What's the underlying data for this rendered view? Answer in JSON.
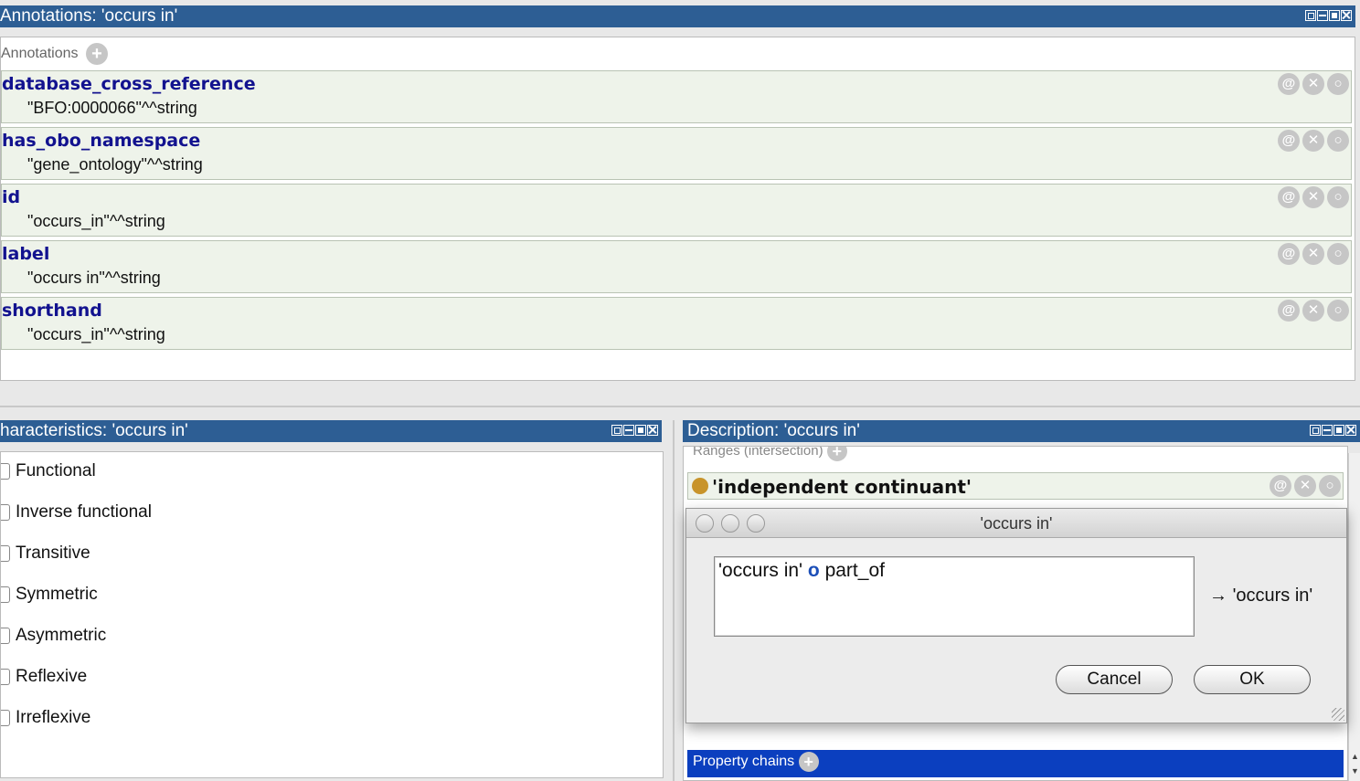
{
  "annotations_panel": {
    "title": "Annotations: 'occurs in'",
    "header_label": "Annotations",
    "rows": [
      {
        "property": "database_cross_reference",
        "value": "\"BFO:0000066\"^^string"
      },
      {
        "property": "has_obo_namespace",
        "value": "\"gene_ontology\"^^string"
      },
      {
        "property": "id",
        "value": "\"occurs_in\"^^string"
      },
      {
        "property": "label",
        "value": "\"occurs in\"^^string"
      },
      {
        "property": "shorthand",
        "value": "\"occurs_in\"^^string"
      }
    ]
  },
  "characteristics_panel": {
    "title": "haracteristics: 'occurs in'",
    "items": [
      "Functional",
      "Inverse functional",
      "Transitive",
      "Symmetric",
      "Asymmetric",
      "Reflexive",
      "Irreflexive"
    ]
  },
  "description_panel": {
    "title": "Description: 'occurs in'",
    "ranges_label": "Ranges (intersection)",
    "range_item": "'independent continuant'",
    "property_chains_label": "Property chains",
    "accent_color": "#0b3fbf"
  },
  "dialog": {
    "title": "'occurs in'",
    "chain_part1": "'occurs in'",
    "chain_operator": "o",
    "chain_part2": "part_of",
    "implies_arrow": "→",
    "implies_target": "'occurs in'",
    "cancel_label": "Cancel",
    "ok_label": "OK"
  },
  "icons": {
    "annotate": "@",
    "delete": "✕",
    "edit": "○",
    "add": "+"
  }
}
